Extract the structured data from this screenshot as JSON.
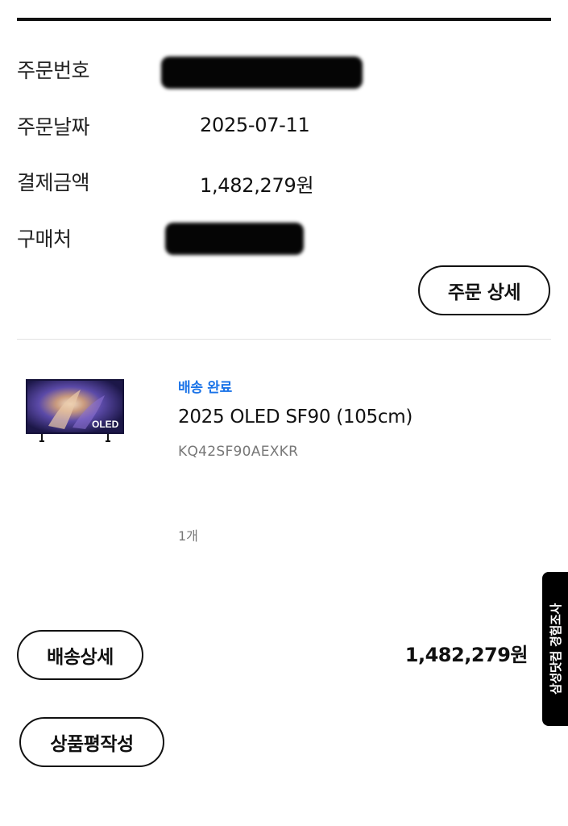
{
  "order": {
    "fields": [
      {
        "label": "주문번호",
        "value": ""
      },
      {
        "label": "주문날짜",
        "value": "2025-07-11"
      },
      {
        "label": "결제금액",
        "value": "1,482,279원"
      },
      {
        "label": "구매처",
        "value": ""
      }
    ],
    "detail_button": "주문 상세"
  },
  "item": {
    "status": "배송 완료",
    "status_color": "#1a73e8",
    "thumbnail_badge": "OLED",
    "name": "2025 OLED SF90 (105cm)",
    "model": "KQ42SF90AEXKR",
    "quantity": "1개",
    "price": "1,482,279원"
  },
  "actions": {
    "shipping_detail": "배송상세",
    "write_review": "상품평작성"
  },
  "survey_tab": {
    "label": "삼성닷컴 경험조사"
  }
}
